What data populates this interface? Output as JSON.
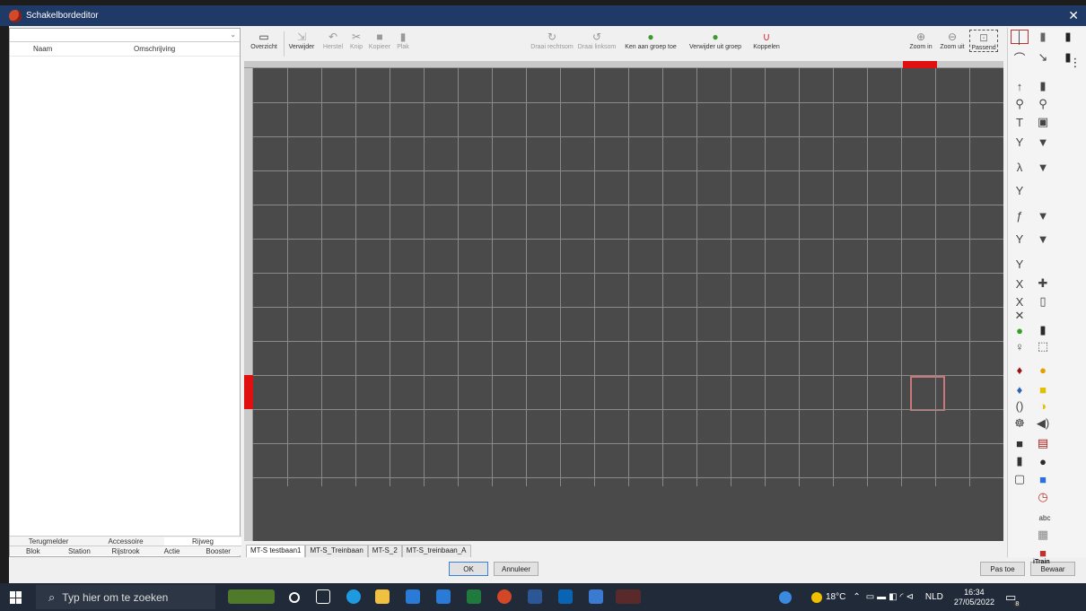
{
  "window": {
    "title": "Schakelbordeditor",
    "close": "✕"
  },
  "left_panel": {
    "columns": [
      "Naam",
      "Omschrijving"
    ],
    "tabs_row1": [
      "Terugmelder",
      "Accessoire",
      "Rijweg"
    ],
    "tabs_row2": [
      "Blok",
      "Station",
      "Rijstrook",
      "Actie",
      "Booster"
    ],
    "active_tab": "Rijweg"
  },
  "toolbar": {
    "overview": "Overzicht",
    "delete": "Verwijder",
    "undo": "Herstel",
    "cut": "Knip",
    "copy": "Kopieer",
    "paste": "Plak",
    "rotate_right": "Draai rechtsom",
    "rotate_left": "Draai linksom",
    "add_group": "Ken aan groep toe",
    "remove_group": "Verwijder uit groep",
    "link": "Koppelen",
    "zoom_in": "Zoom in",
    "zoom_out": "Zoom uit",
    "fit": "Passend"
  },
  "layout_tabs": [
    "MT-S testbaan1",
    "MT-S_Treinbaan",
    "MT-S_2",
    "MT-S_treinbaan_A"
  ],
  "buttons": {
    "ok": "OK",
    "cancel": "Annuleer",
    "apply": "Pas toe",
    "save": "Bewaar"
  },
  "palette": {
    "text_tool": "abc",
    "brand": "iTrain"
  },
  "colors": {
    "titlebar": "#1f3a66",
    "canvas": "#4a4a4a",
    "grid": "#8a8a8a",
    "marker": "#e01010",
    "selection": "#c87878"
  },
  "taskbar": {
    "search_placeholder": "Typ hier om te zoeken",
    "temperature": "18°C",
    "language": "NLD",
    "time": "16:34",
    "date": "27/05/2022",
    "notification_count": "8"
  }
}
